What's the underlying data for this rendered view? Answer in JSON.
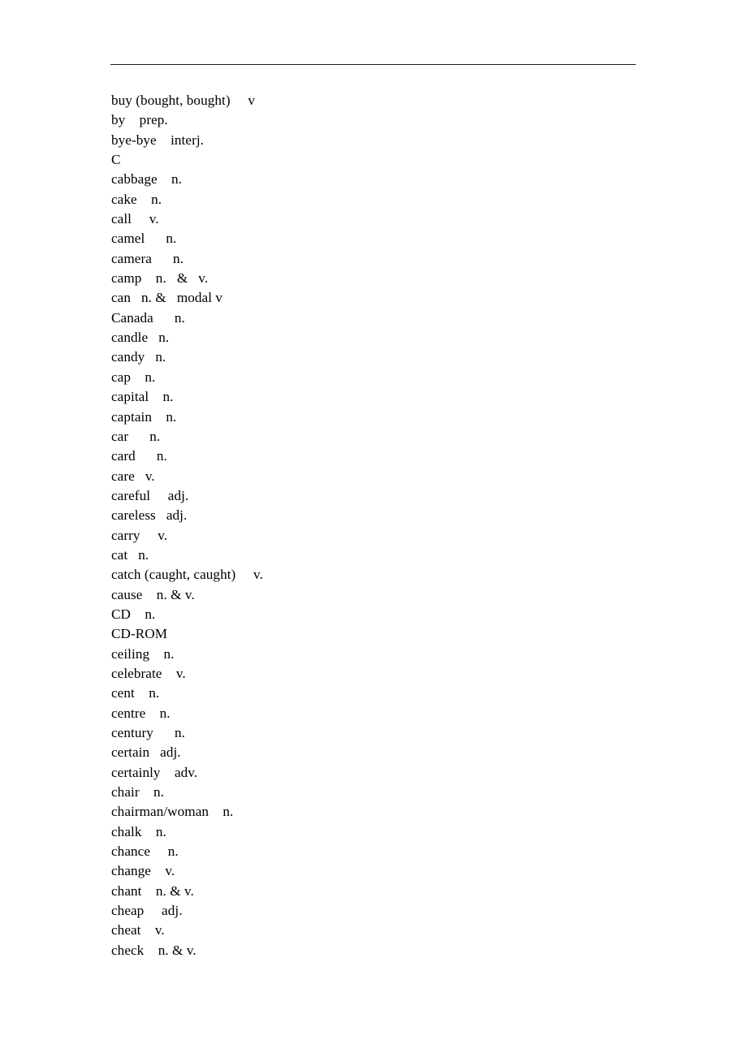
{
  "document": {
    "type": "vocabulary-word-list",
    "page_background": "#ffffff",
    "text_color": "#000000",
    "rule": {
      "present": true,
      "color": "#1a1a1a"
    },
    "section_letter": "C",
    "entries": [
      "buy (bought, bought)     v",
      "by    prep.",
      "bye-bye    interj.",
      "C",
      "cabbage    n.",
      "cake    n.",
      "call     v.",
      "camel      n.",
      "camera      n.",
      "camp    n.   &   v.",
      "can   n. &   modal v",
      "Canada      n.",
      "candle   n.",
      "candy   n.",
      "cap    n.",
      "capital    n.",
      "captain    n.",
      "car      n.",
      "card      n.",
      "care   v.",
      "careful     adj.",
      "careless   adj.",
      "carry     v.",
      "cat   n.",
      "catch (caught, caught)     v.",
      "cause    n. & v.",
      "CD    n.",
      "CD-ROM",
      "ceiling    n.",
      "celebrate    v.",
      "cent    n.",
      "centre    n.",
      "century      n.",
      "certain   adj.",
      "certainly    adv.",
      "chair    n.",
      "chairman/woman    n.",
      "chalk    n.",
      "chance     n.",
      "change    v.",
      "chant    n. & v.",
      "cheap     adj.",
      "cheat    v.",
      "check    n. & v."
    ]
  }
}
